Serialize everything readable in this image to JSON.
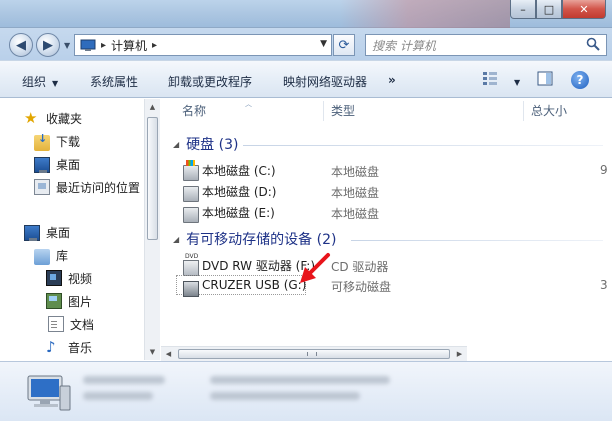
{
  "window": {
    "caption": {
      "minimize": "–",
      "maximize": "□",
      "close": "✕"
    }
  },
  "address": {
    "back": "◀",
    "forward": "▶",
    "path_sep": "▸",
    "crumb": "计算机",
    "crumb_sep": "▸",
    "dropdown": "▼",
    "refresh": "⟳",
    "search_placeholder": "搜索 计算机",
    "search_icon": "search-icon"
  },
  "toolbar": {
    "organize": "组织",
    "system_properties": "系统属性",
    "uninstall": "卸载或更改程序",
    "map_drive": "映射网络驱动器",
    "more": "»",
    "view_arrow": "▼",
    "help": "?"
  },
  "sidebar": {
    "favorites": "收藏夹",
    "downloads": "下载",
    "desktop_fav": "桌面",
    "recent": "最近访问的位置",
    "desktop": "桌面",
    "libraries": "库",
    "videos": "视频",
    "pictures": "图片",
    "documents": "文档",
    "music": "音乐"
  },
  "columns": {
    "name": "名称",
    "type": "类型",
    "total_size": "总大小"
  },
  "groups": {
    "hard_disks": "硬盘 (3)",
    "removable": "有可移动存储的设备 (2)"
  },
  "drives": [
    {
      "name": "本地磁盘 (C:)",
      "type": "本地磁盘",
      "size": "9"
    },
    {
      "name": "本地磁盘 (D:)",
      "type": "本地磁盘",
      "size": ""
    },
    {
      "name": "本地磁盘 (E:)",
      "type": "本地磁盘",
      "size": ""
    },
    {
      "name": "DVD RW 驱动器 (F:)",
      "type": "CD 驱动器",
      "size": ""
    },
    {
      "name": "CRUZER USB (G:)",
      "type": "可移动磁盘",
      "size": "3"
    }
  ],
  "colors": {
    "accent": "#1e3287",
    "arrow": "#e8141b"
  }
}
